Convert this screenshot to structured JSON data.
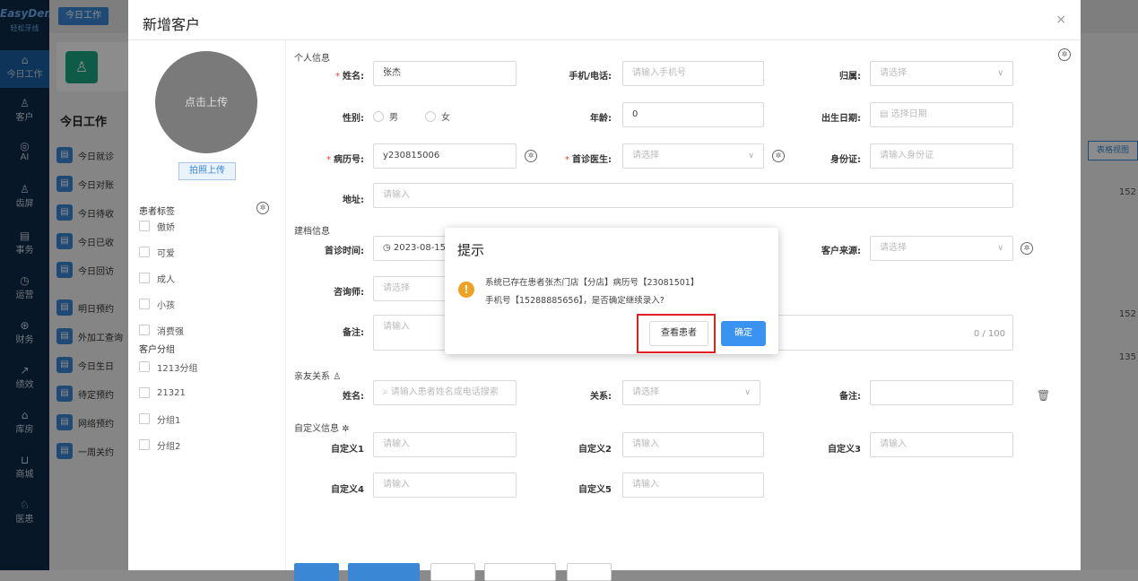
{
  "app": {
    "logo": "EasyDent",
    "logo_sub": "轻松牙线",
    "nav": [
      {
        "icon": "home-icon",
        "glyph": "⌂",
        "label": "今日工作"
      },
      {
        "icon": "user-icon",
        "glyph": "♙",
        "label": "客户"
      },
      {
        "icon": "ai-icon",
        "glyph": "◎",
        "label": "AI"
      },
      {
        "icon": "group-icon",
        "glyph": "♙",
        "label": "齿屏"
      },
      {
        "icon": "task-icon",
        "glyph": "▤",
        "label": "事务"
      },
      {
        "icon": "clock-icon",
        "glyph": "◷",
        "label": "运营"
      },
      {
        "icon": "money-icon",
        "glyph": "⊛",
        "label": "财务"
      },
      {
        "icon": "chart-icon",
        "glyph": "↗",
        "label": "绩效"
      },
      {
        "icon": "warehouse-icon",
        "glyph": "⌂",
        "label": "库房"
      },
      {
        "icon": "cart-icon",
        "glyph": "⊔",
        "label": "商城"
      },
      {
        "icon": "doctor-icon",
        "glyph": "♘",
        "label": "医患"
      }
    ]
  },
  "underpage": {
    "top_tab": "今日工作",
    "heading": "今日工作",
    "right_button": "表格视图",
    "right_numbers": [
      "152",
      "152",
      "135"
    ],
    "today_items": [
      "今日就诊",
      "今日对账",
      "今日待收",
      "今日已收",
      "今日回访",
      "明日预约",
      "外加工查询",
      "今日生日",
      "待定预约",
      "网络预约",
      "一周关约"
    ]
  },
  "drawer": {
    "title": "新增客户",
    "close": "×",
    "avatar_text": "点击上传",
    "photo_button": "拍照上传",
    "patient_tags_label": "患者标签",
    "tags": [
      "傲娇",
      "可爱",
      "成人",
      "小孩",
      "消费强"
    ],
    "customer_group_label": "客户分组",
    "groups": [
      "1213分组",
      "21321",
      "分组1",
      "分组2"
    ],
    "personal_section": "个人信息",
    "archive_section": "建档信息",
    "relatives_section": "亲友关系",
    "custom_section": "自定义信息",
    "fields": {
      "name_label": "姓名:",
      "name_value": "张杰",
      "phone_label": "手机/电话:",
      "phone_placeholder": "请输入手机号",
      "belong_label": "归属:",
      "belong_placeholder": "请选择",
      "gender_label": "性别:",
      "gender_male": "男",
      "gender_female": "女",
      "age_label": "年龄:",
      "age_value": "0",
      "birthday_label": "出生日期:",
      "birthday_placeholder": "选择日期",
      "record_label": "病历号:",
      "record_value": "y230815006",
      "first_doctor_label": "首诊医生:",
      "first_doctor_placeholder": "请选择",
      "idcard_label": "身份证:",
      "idcard_placeholder": "请输入身份证",
      "address_label": "地址:",
      "address_placeholder": "请输入",
      "first_visit_label": "首诊时间:",
      "first_visit_value": "2023-08-15",
      "source_label": "客户来源:",
      "source_placeholder": "请选择",
      "consultant_label": "咨询师:",
      "consultant_placeholder": "请选择",
      "remark_label": "备注:",
      "remark_placeholder": "请输入",
      "remark_counter": "0 / 100",
      "rel_name_label": "姓名:",
      "rel_name_placeholder": "请输入患者姓名或电话搜索",
      "relation_label": "关系:",
      "relation_placeholder": "请选择",
      "rel_remark_label": "备注:",
      "custom1_label": "自定义1",
      "custom2_label": "自定义2",
      "custom3_label": "自定义3",
      "custom4_label": "自定义4",
      "custom5_label": "自定义5",
      "custom_placeholder": "请输入"
    }
  },
  "dialog": {
    "title": "提示",
    "message_line1": "系统已存在患者张杰门店【分店】病历号【23081501】",
    "message_line2": "手机号【15288885656】，是否确定继续录入?",
    "view_button": "查看患者",
    "ok_button": "确定"
  },
  "colors": {
    "primary": "#3a93f0",
    "highlight": "#e02020",
    "warning": "#f0a020"
  }
}
